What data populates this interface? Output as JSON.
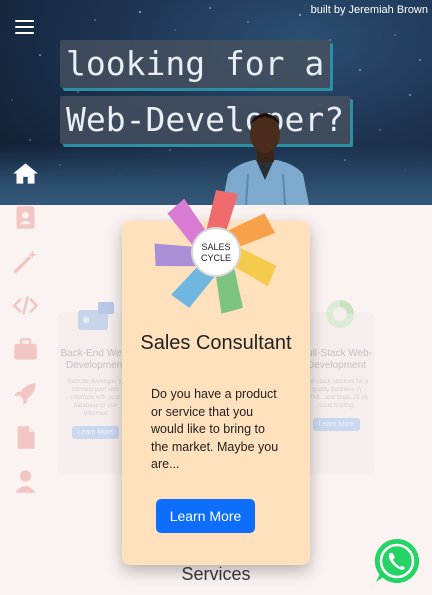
{
  "header": {
    "credit": "built by Jeremiah Brown",
    "headline_line1": "looking for a",
    "headline_line2": "Web-Developer?"
  },
  "sidenav": {
    "items": [
      {
        "icon": "home-icon",
        "label": "Home"
      },
      {
        "icon": "user-card-icon",
        "label": "About"
      },
      {
        "icon": "magic-wand-icon",
        "label": "Skills"
      },
      {
        "icon": "code-icon",
        "label": "Code"
      },
      {
        "icon": "briefcase-icon",
        "label": "Work"
      },
      {
        "icon": "rocket-icon",
        "label": "Projects"
      },
      {
        "icon": "document-icon",
        "label": "Resume"
      },
      {
        "icon": "person-icon",
        "label": "Contact"
      }
    ]
  },
  "background_cards": {
    "left": {
      "title": "Back-End Web-Development",
      "text": "Remote developer to connect your web interface with your database or use Informed",
      "button": "Learn More"
    },
    "right": {
      "title": "Full-Stack Web-Development",
      "text": "Full-stack services for a quality business in HTML, and Node.JS on cloud hosting.",
      "button": "Learn More"
    }
  },
  "modal": {
    "wheel_center_line1": "SALES",
    "wheel_center_line2": "CYCLE",
    "title": "Sales Consultant",
    "description": "Do you have a product or service that you would like to bring to the market. Maybe you are...",
    "button": "Learn More"
  },
  "section_heading": "Services",
  "colors": {
    "accent_button": "#0d6efd",
    "modal_bg": "#ffe1be",
    "whatsapp": "#25d366",
    "headline_shadow": "#2c8fa3",
    "wheel": [
      "#ef6b6b",
      "#f7a24b",
      "#f4cb4c",
      "#7cc47f",
      "#6fb7e0",
      "#a98fd6",
      "#d97ad3"
    ]
  }
}
